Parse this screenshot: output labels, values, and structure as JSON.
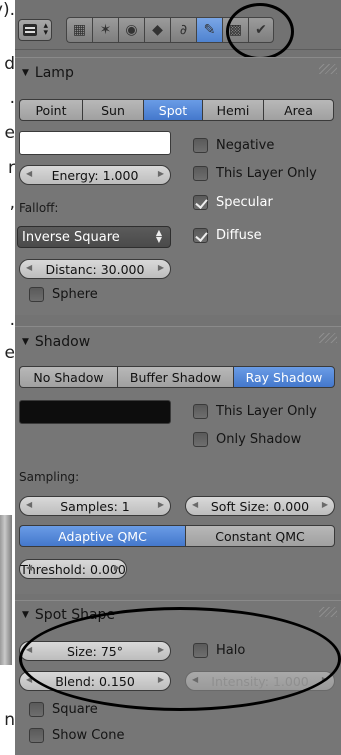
{
  "left_fragments": [
    "y).",
    "d",
    ".",
    "e",
    "r",
    ",",
    ".",
    "e",
    "n"
  ],
  "header": {
    "editor_type_icon": "editor-type-icon",
    "tabs": [
      {
        "name": "render-layers-icon",
        "glyph": "▦"
      },
      {
        "name": "scene-icon",
        "glyph": "✶"
      },
      {
        "name": "world-icon",
        "glyph": "◉"
      },
      {
        "name": "object-icon",
        "glyph": "◆"
      },
      {
        "name": "constraints-icon",
        "glyph": "∂"
      },
      {
        "name": "lamp-data-icon",
        "glyph": "✎"
      },
      {
        "name": "texture-icon",
        "glyph": "▩"
      },
      {
        "name": "particles-icon",
        "glyph": "✔"
      }
    ],
    "active_tab_index": 5
  },
  "lamp": {
    "title": "Lamp",
    "types": [
      "Point",
      "Sun",
      "Spot",
      "Hemi",
      "Area"
    ],
    "active_type": "Spot",
    "color": "#ffffff",
    "energy_label": "Energy: 1.000",
    "falloff_label": "Falloff:",
    "falloff_value": "Inverse Square",
    "distance_label": "Distanc: 30.000",
    "negative_label": "Negative",
    "negative": false,
    "this_layer_only_label": "This Layer Only",
    "this_layer_only": false,
    "specular_label": "Specular",
    "specular": true,
    "diffuse_label": "Diffuse",
    "diffuse": true,
    "sphere_label": "Sphere",
    "sphere": false
  },
  "shadow": {
    "title": "Shadow",
    "types": [
      "No Shadow",
      "Buffer Shadow",
      "Ray Shadow"
    ],
    "active_type": "Ray Shadow",
    "color": "#0d0d0d",
    "this_layer_only_label": "This Layer Only",
    "only_shadow_label": "Only Shadow",
    "sampling_label": "Sampling:",
    "samples_label": "Samples: 1",
    "soft_size_label": "Soft Size: 0.000",
    "qmc_options": [
      "Adaptive QMC",
      "Constant QMC"
    ],
    "active_qmc": "Adaptive QMC",
    "threshold_label": "Threshold: 0.000"
  },
  "spot_shape": {
    "title": "Spot Shape",
    "size_label": "Size: 75°",
    "blend_label": "Blend: 0.150",
    "halo_label": "Halo",
    "intensity_label": "Intensity: 1.000",
    "square_label": "Square",
    "show_cone_label": "Show Cone"
  }
}
